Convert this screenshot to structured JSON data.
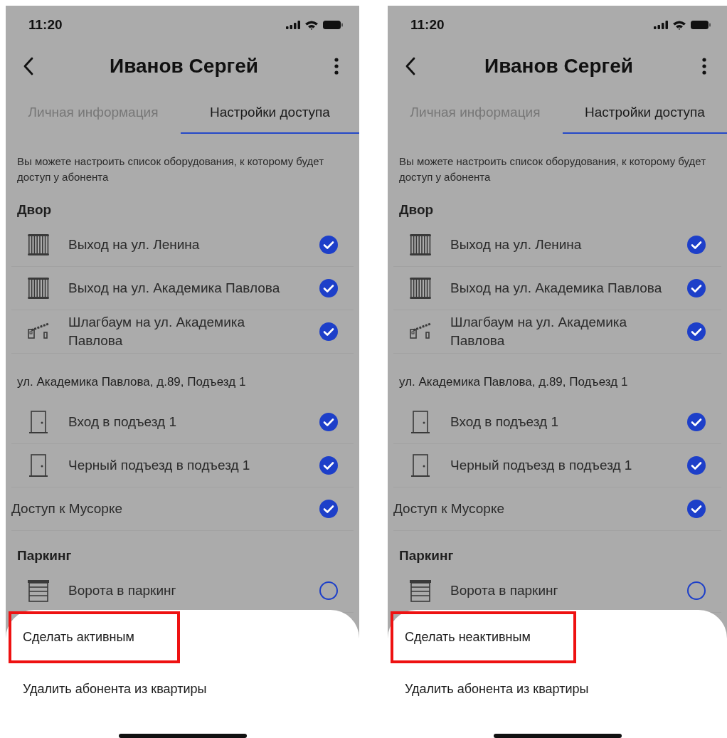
{
  "screens": [
    {
      "status_bar": {
        "time": "11:20"
      },
      "header": {
        "title": "Иванов Сергей"
      },
      "tabs": [
        {
          "label": "Личная информация",
          "selected": false
        },
        {
          "label": "Настройки доступа",
          "selected": true
        }
      ],
      "description": "Вы можете настроить список оборудования, к которому будет доступ у абонента",
      "list": [
        {
          "kind": "heading",
          "label": "Двор"
        },
        {
          "kind": "fence",
          "label": "Выход на ул. Ленина",
          "checked": true
        },
        {
          "kind": "fence",
          "label": "Выход на ул. Академика Павлова",
          "checked": true
        },
        {
          "kind": "barrier",
          "label": "Шлагбаум на ул. Академика Павлова",
          "checked": true
        },
        {
          "kind": "subheading",
          "label": "ул. Академика Павлова, д.89, Подъезд 1"
        },
        {
          "kind": "door",
          "label": "Вход в подъезд 1",
          "checked": true
        },
        {
          "kind": "door",
          "label": "Черный подъезд в подъезд 1",
          "checked": true
        },
        {
          "kind": "plain",
          "label": "Доступ к Мусорке",
          "checked": true
        },
        {
          "kind": "heading",
          "label": "Паркинг"
        },
        {
          "kind": "shutter",
          "label": "Ворота в паркинг",
          "checked": false
        }
      ],
      "sheet": {
        "actions": [
          {
            "label": "Сделать активным",
            "highlighted": true
          },
          {
            "label": "Удалить абонента из квартиры",
            "highlighted": false
          }
        ]
      }
    },
    {
      "status_bar": {
        "time": "11:20"
      },
      "header": {
        "title": "Иванов Сергей"
      },
      "tabs": [
        {
          "label": "Личная информация",
          "selected": false
        },
        {
          "label": "Настройки доступа",
          "selected": true
        }
      ],
      "description": "Вы можете настроить список оборудования, к которому будет доступ у абонента",
      "list": [
        {
          "kind": "heading",
          "label": "Двор"
        },
        {
          "kind": "fence",
          "label": "Выход на ул. Ленина",
          "checked": true
        },
        {
          "kind": "fence",
          "label": "Выход на ул. Академика Павлова",
          "checked": true
        },
        {
          "kind": "barrier",
          "label": "Шлагбаум на ул. Академика Павлова",
          "checked": true
        },
        {
          "kind": "subheading",
          "label": "ул. Академика Павлова, д.89, Подъезд 1"
        },
        {
          "kind": "door",
          "label": "Вход в подъезд 1",
          "checked": true
        },
        {
          "kind": "door",
          "label": "Черный подъезд в подъезд 1",
          "checked": true
        },
        {
          "kind": "plain",
          "label": "Доступ к Мусорке",
          "checked": true
        },
        {
          "kind": "heading",
          "label": "Паркинг"
        },
        {
          "kind": "shutter",
          "label": "Ворота в паркинг",
          "checked": false
        }
      ],
      "sheet": {
        "actions": [
          {
            "label": "Сделать неактивным",
            "highlighted": true
          },
          {
            "label": "Удалить абонента из квартиры",
            "highlighted": false
          }
        ]
      }
    }
  ]
}
